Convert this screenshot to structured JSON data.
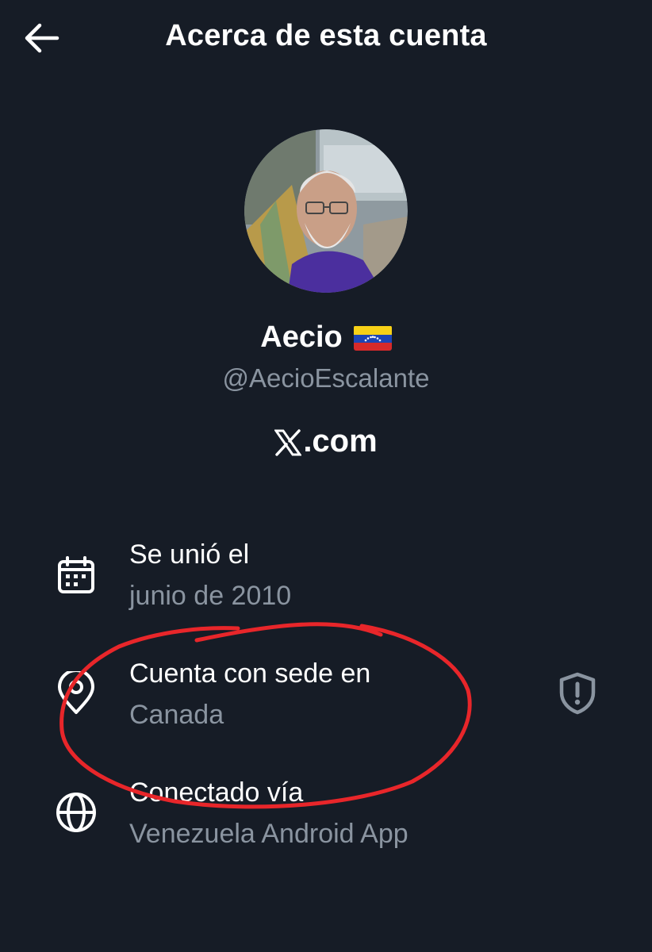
{
  "header": {
    "title": "Acerca de esta cuenta",
    "back_icon": "arrow-left-icon"
  },
  "profile": {
    "display_name": "Aecio",
    "flag": "venezuela-flag-icon",
    "handle": "@AecioEscalante",
    "site": ".com",
    "site_logo": "x-logo-icon"
  },
  "info": {
    "joined": {
      "label": "Se unió el",
      "value": "junio de 2010",
      "icon": "calendar-icon"
    },
    "based_in": {
      "label": "Cuenta con sede en",
      "value": "Canada",
      "icon": "location-pin-icon",
      "action_icon": "shield-alert-icon"
    },
    "connected_via": {
      "label": "Conectado vía",
      "value": "Venezuela Android App",
      "icon": "globe-icon"
    }
  },
  "colors": {
    "background": "#161c26",
    "primary_text": "#ffffff",
    "secondary_text": "#8a94a0",
    "annotation": "#e8262a"
  }
}
